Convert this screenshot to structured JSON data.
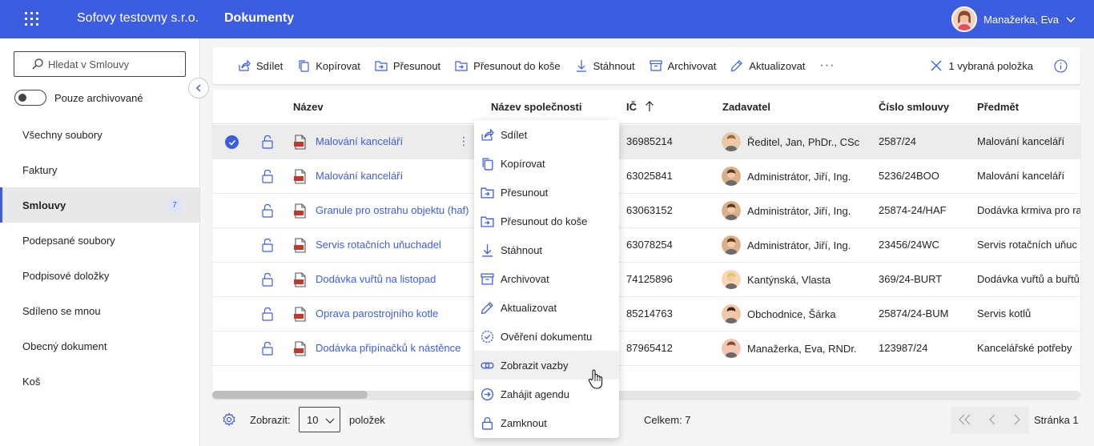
{
  "header": {
    "company": "Sofovy testovny s.r.o.",
    "app_title": "Dokumenty",
    "user_name": "Manažerka, Eva",
    "accent": "#3d5de0"
  },
  "sidebar": {
    "search_placeholder": "Hledat v Smlouvy",
    "archive_toggle_label": "Pouze archivované",
    "items": [
      {
        "label": "Všechny soubory"
      },
      {
        "label": "Faktury"
      },
      {
        "label": "Smlouvy",
        "badge": "7",
        "active": true
      },
      {
        "label": "Podepsané soubory"
      },
      {
        "label": "Podpisové doložky"
      },
      {
        "label": "Sdíleno se mnou"
      },
      {
        "label": "Obecný dokument"
      },
      {
        "label": "Koš"
      }
    ]
  },
  "toolbar": {
    "share": "Sdílet",
    "copy": "Kopírovat",
    "move": "Přesunout",
    "move_to_trash": "Přesunout do koše",
    "download": "Stáhnout",
    "archive": "Archivovat",
    "update": "Aktualizovat",
    "more": "···",
    "selection": "1 vybraná položka"
  },
  "table": {
    "columns": {
      "name": "Název",
      "company": "Název společnosti",
      "ic": "IČ",
      "requester": "Zadavatel",
      "contract_no": "Číslo smlouvy",
      "subject": "Předmět"
    },
    "rows": [
      {
        "name": "Malování kanceláří",
        "ic": "36985214",
        "requester": "Ředitel, Jan, PhDr., CSc",
        "contract_no": "2587/24",
        "subject": "Malování kanceláří",
        "selected": true
      },
      {
        "name": "Malování kanceláří",
        "ic": "63025841",
        "requester": "Administrátor, Jiří, Ing.",
        "contract_no": "5236/24BOO",
        "subject": "Malování kanceláří"
      },
      {
        "name": "Granule pro ostrahu objektu (haf)",
        "ic": "63063152",
        "requester": "Administrátor, Jiří, Ing.",
        "contract_no": "25874-24/HAF",
        "subject": "Dodávka krmiva pro ra"
      },
      {
        "name": "Servis rotačních uňuchadel",
        "ic": "63078254",
        "requester": "Administrátor, Jiří, Ing.",
        "contract_no": "23456/24WC",
        "subject": "Servis rotačních uňuc"
      },
      {
        "name": "Dodávka vuřtů na listopad",
        "ic": "74125896",
        "requester": "Kantýnská, Vlasta",
        "contract_no": "369/24-BURT",
        "subject": "Dodávka vuřtů a buřtů"
      },
      {
        "name": "Oprava parostrojního kotle",
        "ic": "85214763",
        "requester": "Obchodnice, Šárka",
        "contract_no": "25874/24-BUM",
        "subject": "Servis kotlů"
      },
      {
        "name": "Dodávka připínačků k nástěnce",
        "ic": "87965412",
        "requester": "Manažerka, Eva, RNDr.",
        "contract_no": "123987/24",
        "subject": "Kancelářské potřeby"
      }
    ]
  },
  "context_menu": {
    "items": [
      {
        "label": "Sdílet"
      },
      {
        "label": "Kopírovat"
      },
      {
        "label": "Přesunout"
      },
      {
        "label": "Přesunout do koše"
      },
      {
        "label": "Stáhnout"
      },
      {
        "label": "Archivovat"
      },
      {
        "label": "Aktualizovat"
      },
      {
        "label": "Ověření dokumentu"
      },
      {
        "label": "Zobrazit vazby",
        "hovered": true
      },
      {
        "label": "Zahájit agendu"
      },
      {
        "label": "Zamknout"
      }
    ]
  },
  "footer": {
    "show_label": "Zobrazit:",
    "page_size": "10",
    "items_label": "položek",
    "total": "Celkem: 7",
    "page": "Stránka 1"
  }
}
